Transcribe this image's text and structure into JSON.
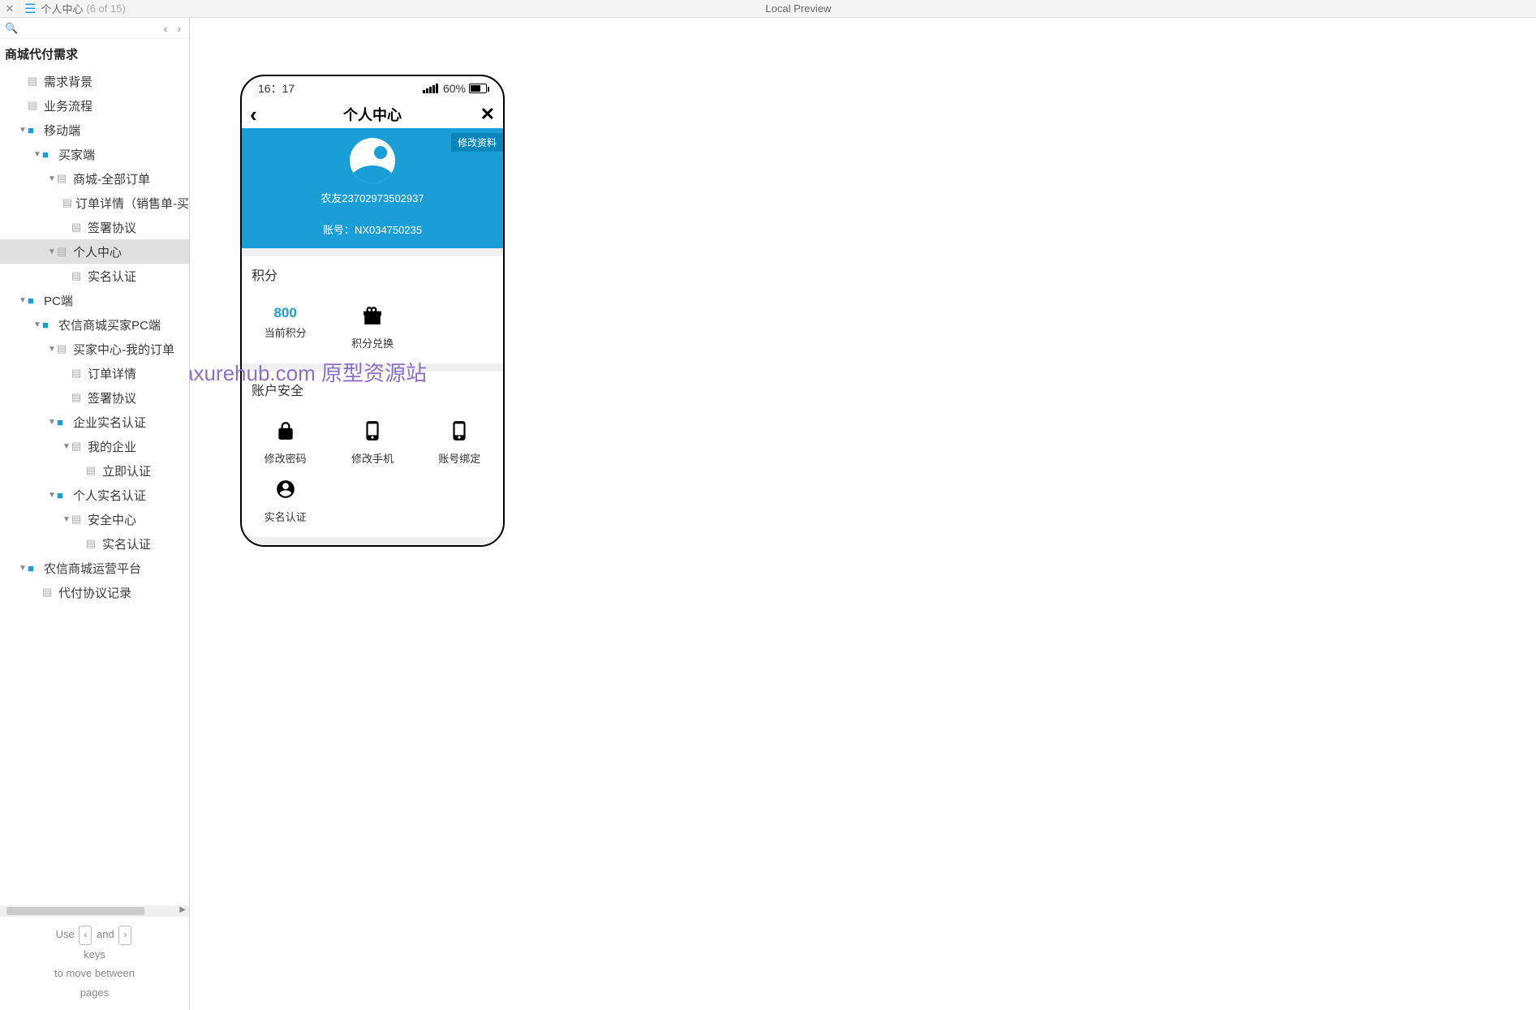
{
  "topbar": {
    "title": "个人中心",
    "count": "(6 of 15)",
    "center": "Local Preview"
  },
  "sidebar": {
    "root_title": "商城代付需求",
    "hint": {
      "use": "Use",
      "and": "and",
      "keys": "keys",
      "line2": "to move between",
      "line3": "pages"
    }
  },
  "tree": [
    {
      "lvl": 0,
      "type": "page",
      "label": "需求背景"
    },
    {
      "lvl": 0,
      "type": "page",
      "label": "业务流程"
    },
    {
      "lvl": 0,
      "type": "folder",
      "label": "移动端",
      "open": true
    },
    {
      "lvl": 1,
      "type": "folder",
      "label": "买家端",
      "open": true
    },
    {
      "lvl": 2,
      "type": "page",
      "label": "商城-全部订单",
      "open": true
    },
    {
      "lvl": 3,
      "type": "page",
      "label": "订单详情（销售单-买"
    },
    {
      "lvl": 3,
      "type": "page",
      "label": "签署协议"
    },
    {
      "lvl": 2,
      "type": "page",
      "label": "个人中心",
      "open": true,
      "selected": true
    },
    {
      "lvl": 3,
      "type": "page",
      "label": "实名认证"
    },
    {
      "lvl": 0,
      "type": "folder",
      "label": "PC端",
      "open": true
    },
    {
      "lvl": 1,
      "type": "folder",
      "label": "农信商城买家PC端",
      "open": true
    },
    {
      "lvl": 2,
      "type": "page",
      "label": "买家中心-我的订单",
      "open": true
    },
    {
      "lvl": 3,
      "type": "page",
      "label": "订单详情"
    },
    {
      "lvl": 3,
      "type": "page",
      "label": "签署协议"
    },
    {
      "lvl": 2,
      "type": "folder",
      "label": "企业实名认证",
      "open": true
    },
    {
      "lvl": 3,
      "type": "page",
      "label": "我的企业",
      "open": true
    },
    {
      "lvl": 4,
      "type": "page",
      "label": "立即认证"
    },
    {
      "lvl": 2,
      "type": "folder",
      "label": "个人实名认证",
      "open": true
    },
    {
      "lvl": 3,
      "type": "page",
      "label": "安全中心",
      "open": true
    },
    {
      "lvl": 4,
      "type": "page",
      "label": "实名认证"
    },
    {
      "lvl": 0,
      "type": "folder",
      "label": "农信商城运营平台",
      "open": true
    },
    {
      "lvl": 1,
      "type": "page",
      "label": "代付协议记录"
    }
  ],
  "phone": {
    "status": {
      "time": "16：17",
      "battery_pct": "60%"
    },
    "titlebar": {
      "title": "个人中心"
    },
    "profile": {
      "edit": "修改资料",
      "username": "农友23702973502937",
      "account_label": "账号：",
      "account": "NX034750235"
    },
    "points": {
      "header": "积分",
      "cells": [
        {
          "value": "800",
          "label": "当前积分",
          "kind": "number"
        },
        {
          "value": "",
          "label": "积分兑换",
          "kind": "gift"
        }
      ]
    },
    "security": {
      "header": "账户安全",
      "cells": [
        {
          "label": "修改密码",
          "icon": "lock"
        },
        {
          "label": "修改手机",
          "icon": "phone"
        },
        {
          "label": "账号绑定",
          "icon": "phone"
        },
        {
          "label": "实名认证",
          "icon": "person"
        }
      ]
    }
  },
  "watermark": "axurehub.com 原型资源站"
}
